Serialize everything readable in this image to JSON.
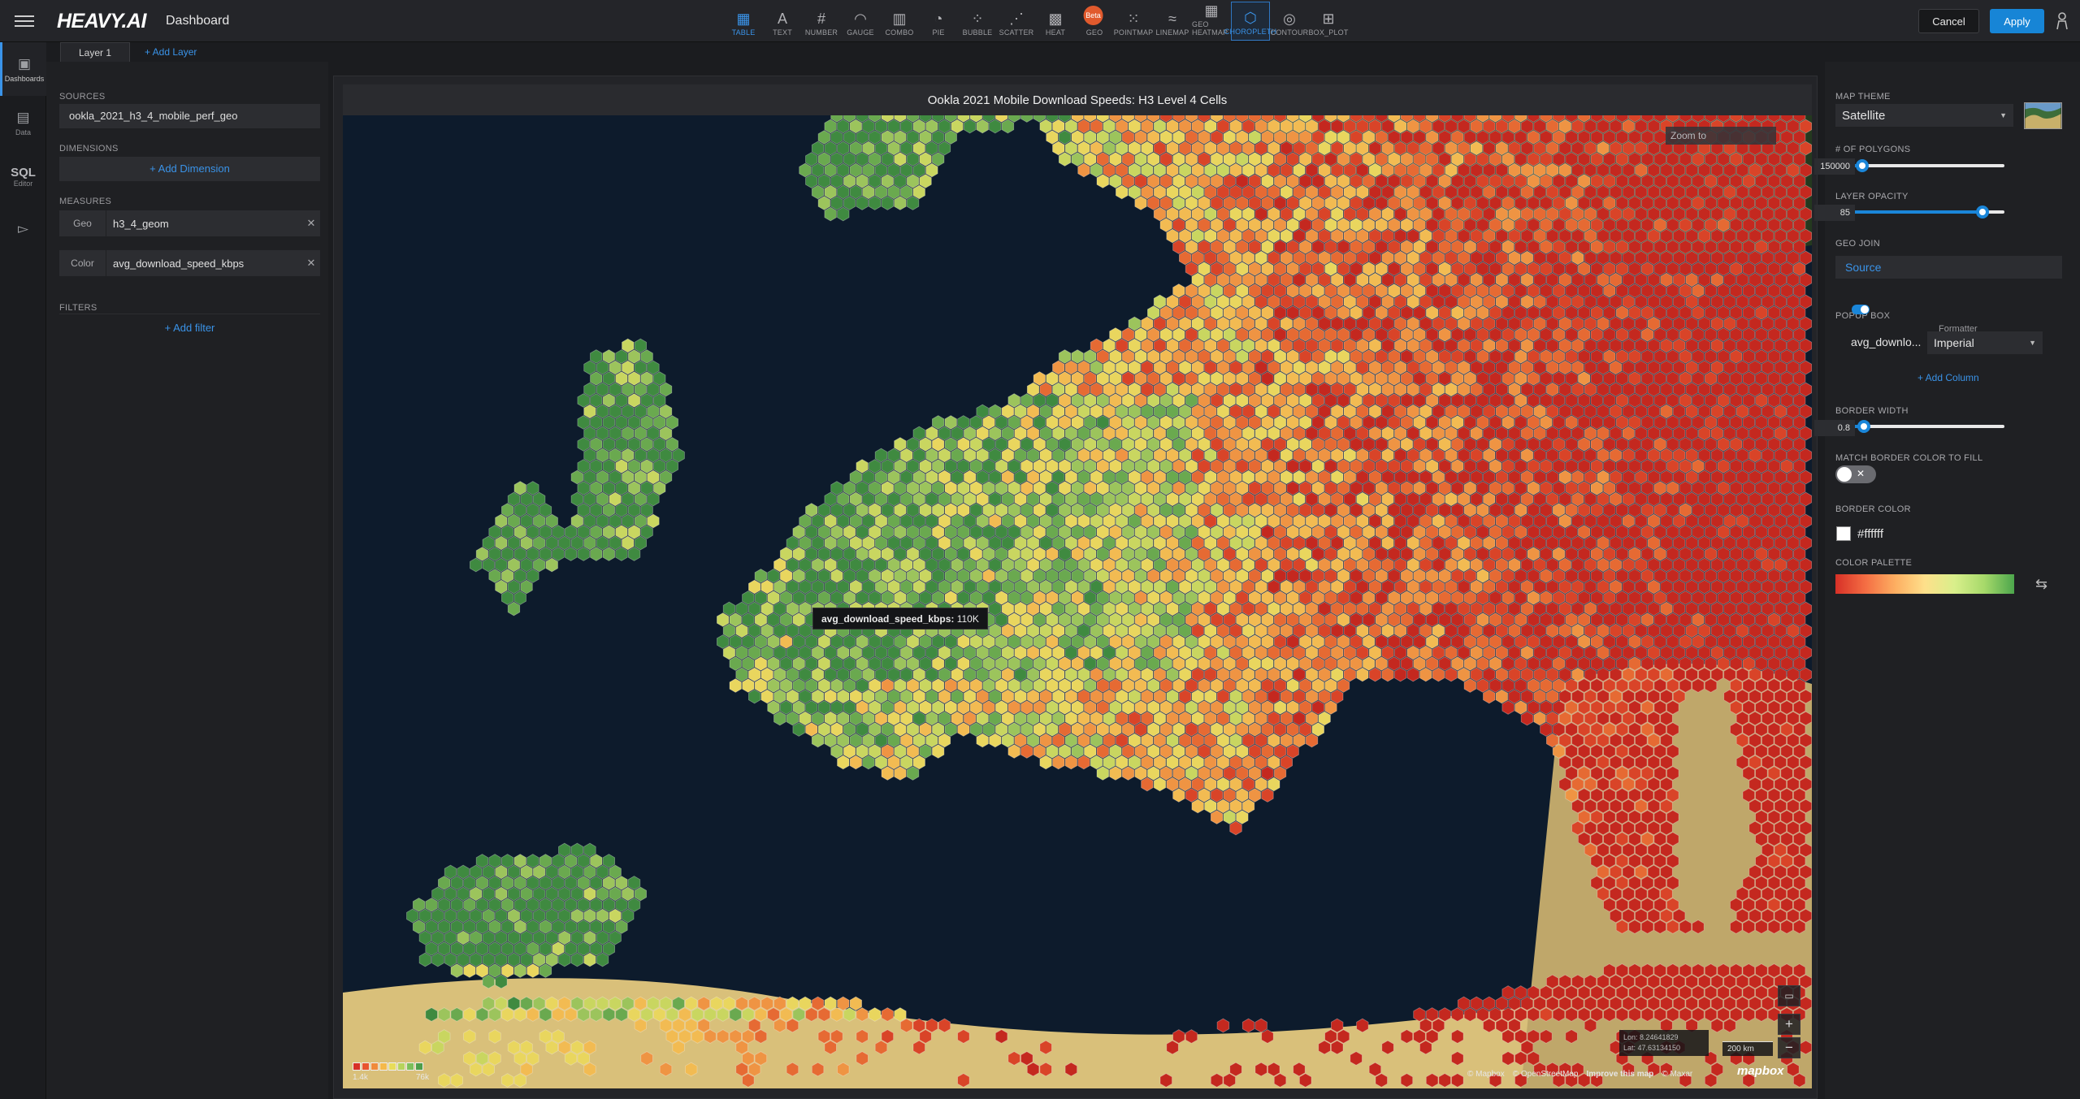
{
  "app": {
    "brand": "HEAVY.AI",
    "page_title": "Dashboard"
  },
  "toolbar": {
    "chart_types": [
      {
        "label": "TABLE",
        "icon": "table-icon",
        "glyph": "▦"
      },
      {
        "label": "TEXT",
        "icon": "text-icon",
        "glyph": "A"
      },
      {
        "label": "NUMBER",
        "icon": "number-icon",
        "glyph": "#"
      },
      {
        "label": "GAUGE",
        "icon": "gauge-icon",
        "glyph": "◠"
      },
      {
        "label": "COMBO",
        "icon": "combo-icon",
        "glyph": "▥"
      },
      {
        "label": "PIE",
        "icon": "pie-icon",
        "glyph": "◔"
      },
      {
        "label": "BUBBLE",
        "icon": "bubble-icon",
        "glyph": "⁘"
      },
      {
        "label": "SCATTER",
        "icon": "scatter-icon",
        "glyph": "⋰"
      },
      {
        "label": "HEAT",
        "icon": "heatmap-icon",
        "glyph": "▩"
      },
      {
        "label": "GEO",
        "icon": "geo-icon",
        "glyph": "◍",
        "badge": "Beta"
      },
      {
        "label": "POINTMAP",
        "icon": "pointmap-icon",
        "glyph": "⁙"
      },
      {
        "label": "LINEMAP",
        "icon": "linemap-icon",
        "glyph": "≈"
      },
      {
        "label": "GEO HEATMAP",
        "icon": "geo-heatmap-icon",
        "glyph": "▦"
      },
      {
        "label": "CHOROPLETH",
        "icon": "choropleth-icon",
        "glyph": "⬡"
      },
      {
        "label": "CONTOUR",
        "icon": "contour-icon",
        "glyph": "◎"
      },
      {
        "label": "BOX_PLOT",
        "icon": "box-plot-icon",
        "glyph": "⊞"
      }
    ],
    "cancel_label": "Cancel",
    "apply_label": "Apply"
  },
  "rail": [
    {
      "label": "Dashboards",
      "icon": "dashboards-icon",
      "glyph": "▣"
    },
    {
      "label": "Data",
      "icon": "data-icon",
      "glyph": "▤"
    },
    {
      "label": "Editor",
      "top": "SQL",
      "icon": "sql-editor-icon"
    },
    {
      "label": "",
      "icon": "terminal-icon",
      "glyph": "▻"
    }
  ],
  "layers": {
    "tab": "Layer 1",
    "add": "+ Add Layer"
  },
  "left": {
    "sources_label": "SOURCES",
    "source": "ookla_2021_h3_4_mobile_perf_geo",
    "dimensions_label": "DIMENSIONS",
    "add_dimension": "+ Add Dimension",
    "measures_label": "MEASURES",
    "measures": [
      {
        "label": "Geo",
        "value": "h3_4_geom"
      },
      {
        "label": "Color",
        "value": "avg_download_speed_kbps"
      }
    ],
    "filters_label": "FILTERS",
    "add_filter": "+ Add filter"
  },
  "chart": {
    "title": "Ookla 2021 Mobile Download Speeds: H3 Level 4 Cells",
    "zoom_to": "Zoom to",
    "tooltip_key": "avg_download_speed_kbps:",
    "tooltip_val": " 110K",
    "coords_lon": "Lon: 8.24641829",
    "coords_lat": "Lat: 47.63134150",
    "scale": "200 km",
    "attribution": [
      "© Mapbox",
      "© OpenStreetMap",
      "Improve this map",
      "© Maxar"
    ],
    "mapbox": "mapbox",
    "legend_min": "1.4k",
    "legend_max": "76k",
    "legend_colors": [
      "#d73027",
      "#e8552f",
      "#f08a3a",
      "#f5b94a",
      "#e8dc5a",
      "#b7d35c",
      "#7cbf5a",
      "#4e9e4a"
    ]
  },
  "right": {
    "map_theme_label": "MAP THEME",
    "map_theme": "Satellite",
    "polygons_label": "# OF POLYGONS",
    "polygons": "150000",
    "polygons_level": 0.16,
    "opacity_label": "LAYER OPACITY",
    "opacity": "85",
    "opacity_level": 0.87,
    "geojoin_label": "GEO JOIN",
    "geojoin": "Source",
    "popup_label": "POPUP BOX",
    "popup_col": "avg_downlo...",
    "formatter_label": "Formatter",
    "formatter": "Imperial",
    "add_column": "+ Add Column",
    "border_width_label": "BORDER WIDTH",
    "border_width": "0.8",
    "border_width_level": 0.17,
    "match_label": "MATCH BORDER COLOR TO FILL",
    "border_color_label": "BORDER COLOR",
    "border_color": "#ffffff",
    "palette_label": "COLOR PALETTE",
    "palette": [
      "#d73027",
      "#f46d43",
      "#fdae61",
      "#fee08b",
      "#d9ef8b",
      "#a6d96a",
      "#4ca64c"
    ]
  }
}
